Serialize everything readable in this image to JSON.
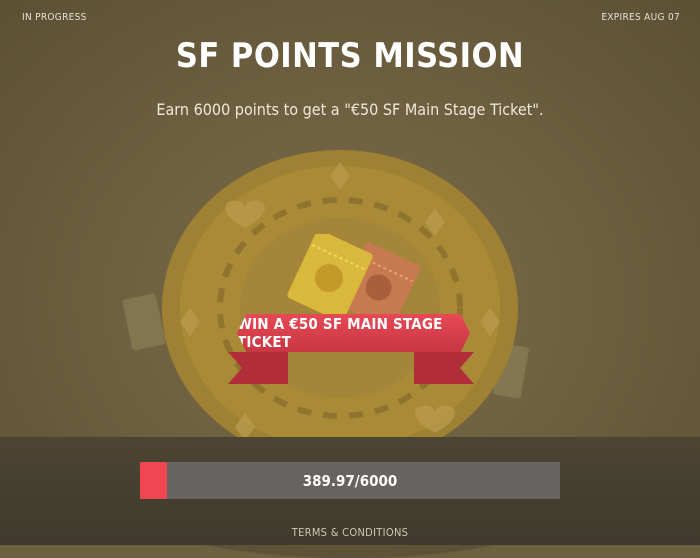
{
  "header": {
    "status": "IN PROGRESS",
    "expires": "EXPIRES AUG 07"
  },
  "mission": {
    "title": "SF POINTS MISSION",
    "description": "Earn 6000 points to get a \"€50 SF Main Stage Ticket\"."
  },
  "reward": {
    "banner_label": "WIN A €50 SF MAIN STAGE TICKET"
  },
  "progress": {
    "current": 389.97,
    "goal": 6000,
    "label": "389.97/6000"
  },
  "footer": {
    "terms_label": "TERMS & CONDITIONS"
  },
  "colors": {
    "accent": "#f04651",
    "banner": "#e64a55",
    "chip": "#b8942f",
    "ticket_gold": "#d9b83c",
    "ticket_copper": "#c7794f"
  },
  "icons": [
    "poker-chip-icon",
    "ticket-icon",
    "ribbon-banner-icon"
  ]
}
